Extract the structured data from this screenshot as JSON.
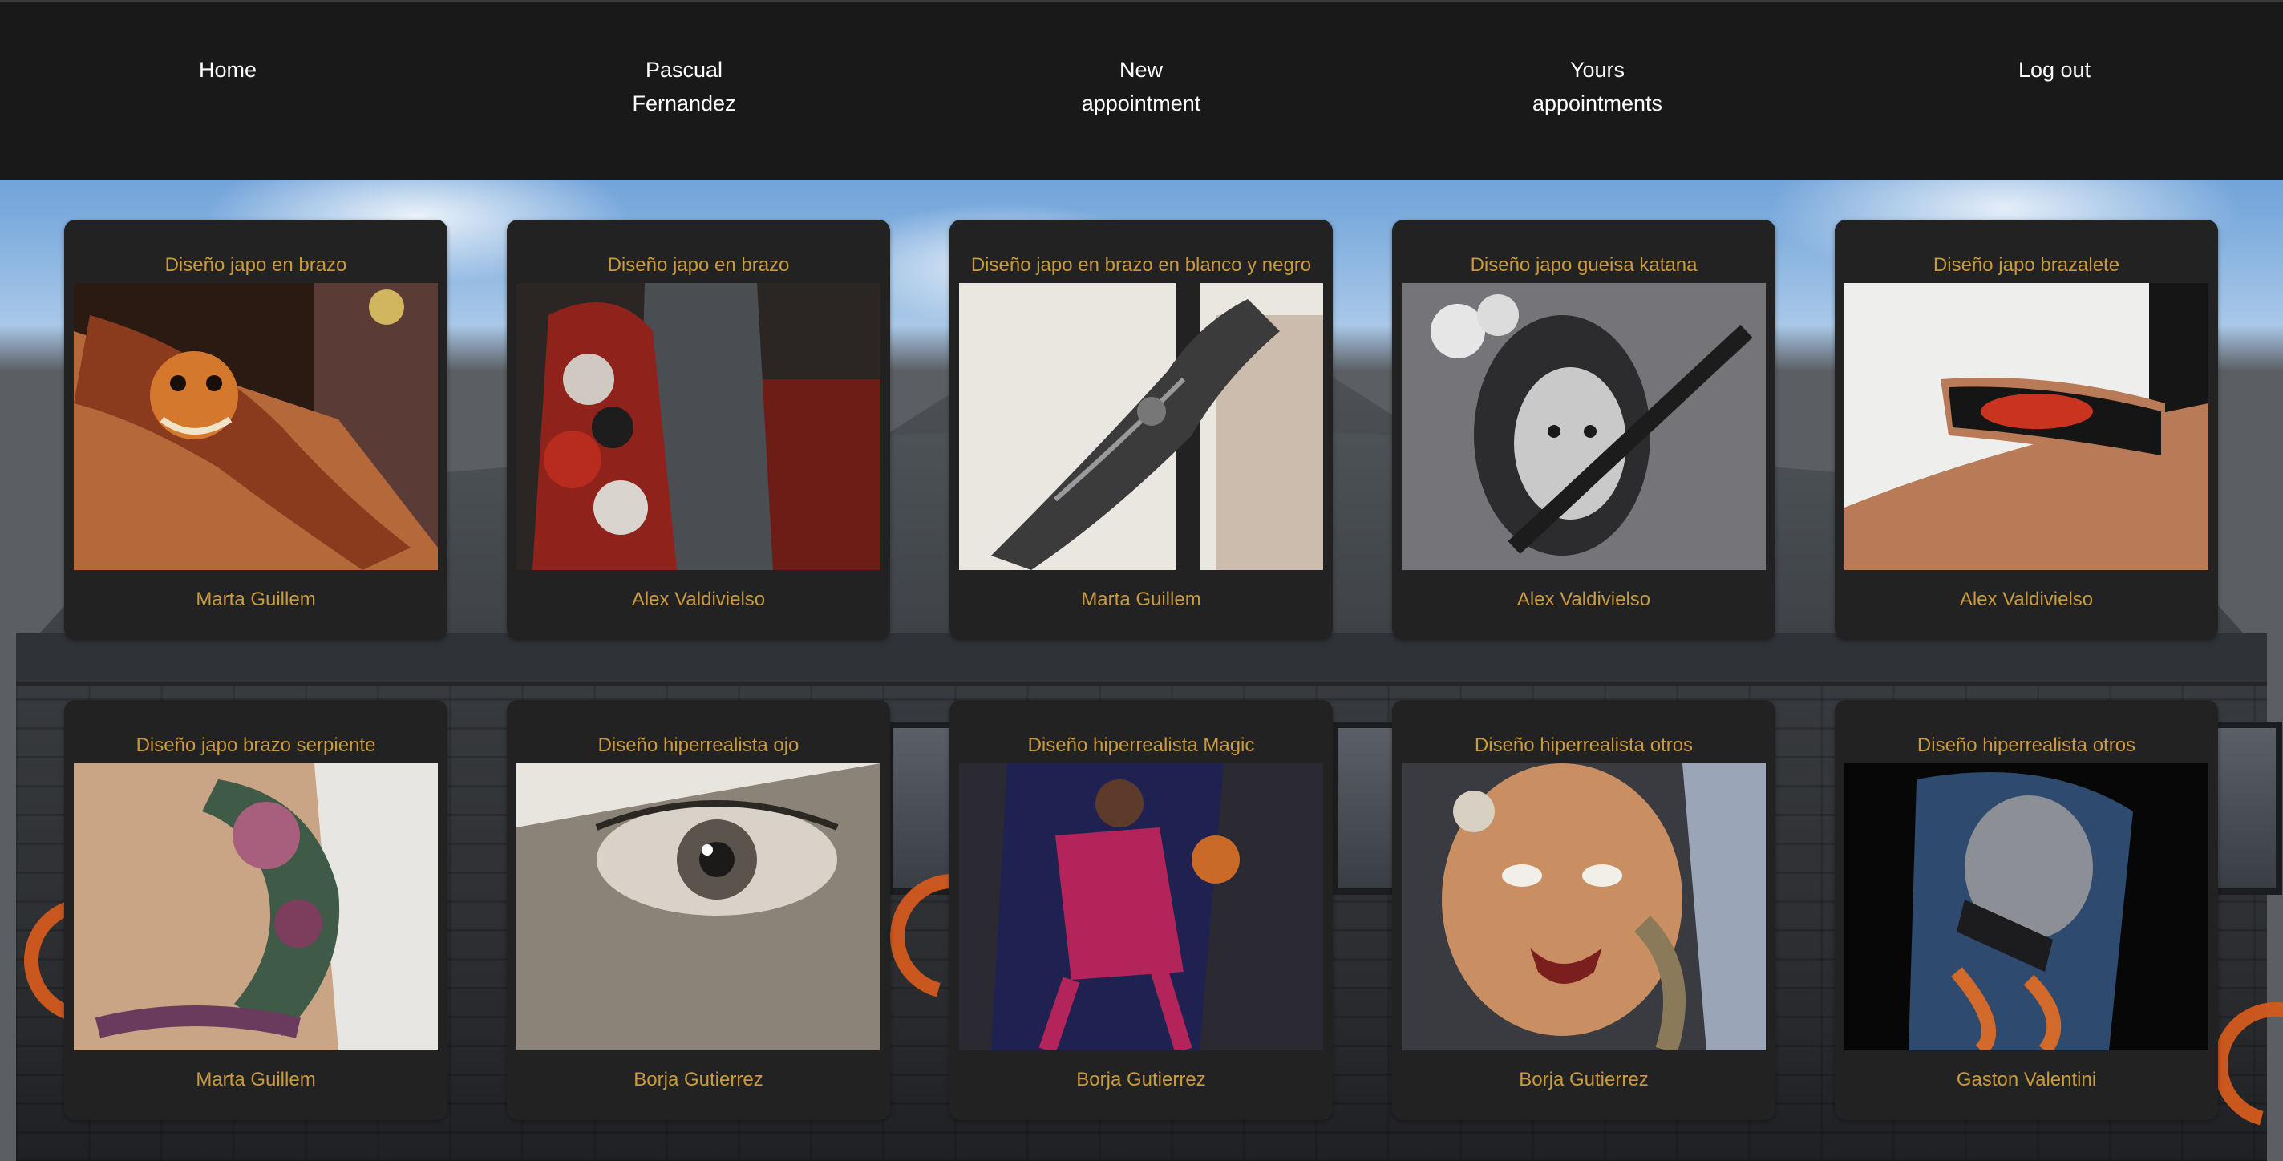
{
  "nav": {
    "home": "Home",
    "user_first": "Pascual",
    "user_last": "Fernandez",
    "new_line1": "New",
    "new_line2": "appointment",
    "yours_line1": "Yours",
    "yours_line2": "appointments",
    "logout": "Log out"
  },
  "colors": {
    "header_bg": "#191919",
    "card_bg": "#222223",
    "accent_gold": "#c99a3e",
    "nav_text": "#ffffff"
  },
  "designs": [
    {
      "title": "Diseño japo en brazo",
      "artist": "Marta Guillem",
      "image": "tattoo-photo"
    },
    {
      "title": "Diseño japo en brazo",
      "artist": "Alex Valdivielso",
      "image": "tattoo-photo"
    },
    {
      "title": "Diseño japo en brazo en blanco y negro",
      "artist": "Marta Guillem",
      "image": "tattoo-photo"
    },
    {
      "title": "Diseño japo gueisa katana",
      "artist": "Alex Valdivielso",
      "image": "tattoo-photo"
    },
    {
      "title": "Diseño japo brazalete",
      "artist": "Alex Valdivielso",
      "image": "tattoo-photo"
    },
    {
      "title": "Diseño japo brazo serpiente",
      "artist": "Marta Guillem",
      "image": "tattoo-photo"
    },
    {
      "title": "Diseño hiperrealista ojo",
      "artist": "Borja Gutierrez",
      "image": "tattoo-photo"
    },
    {
      "title": "Diseño hiperrealista Magic",
      "artist": "Borja Gutierrez",
      "image": "tattoo-photo"
    },
    {
      "title": "Diseño hiperrealista otros",
      "artist": "Borja Gutierrez",
      "image": "tattoo-photo"
    },
    {
      "title": "Diseño hiperrealista otros",
      "artist": "Gaston Valentini",
      "image": "tattoo-photo"
    }
  ]
}
